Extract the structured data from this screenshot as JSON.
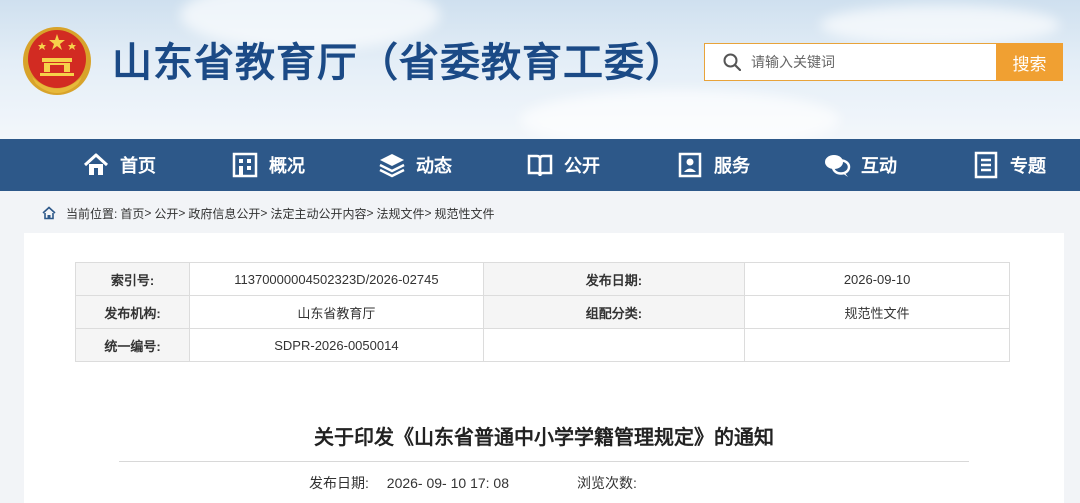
{
  "header": {
    "site_title": "山东省教育厅（省委教育工委）",
    "search_placeholder": "请输入关键词",
    "search_button": "搜索"
  },
  "nav": {
    "items": [
      {
        "label": "首页",
        "icon": "home-icon"
      },
      {
        "label": "概况",
        "icon": "building-icon"
      },
      {
        "label": "动态",
        "icon": "stack-icon"
      },
      {
        "label": "公开",
        "icon": "book-icon"
      },
      {
        "label": "服务",
        "icon": "service-icon"
      },
      {
        "label": "互动",
        "icon": "chat-icon"
      },
      {
        "label": "专题",
        "icon": "document-icon"
      }
    ]
  },
  "breadcrumb": {
    "prefix": "当前位置:",
    "items": [
      "首页",
      "公开",
      "政府信息公开",
      "法定主动公开内容",
      "法规文件",
      "规范性文件"
    ],
    "separator": ">"
  },
  "meta": {
    "index_label": "索引号:",
    "index_value": "11370000004502323D/2026-02745",
    "date_label": "发布日期:",
    "date_value": "2026-09-10",
    "org_label": "发布机构:",
    "org_value": "山东省教育厅",
    "category_label": "组配分类:",
    "category_value": "规范性文件",
    "code_label": "统一编号:",
    "code_value": "SDPR-2026-0050014"
  },
  "article": {
    "title": "关于印发《山东省普通中小学学籍管理规定》的通知",
    "publish_label": "发布日期:",
    "publish_value": "2026- 09- 10 17: 08",
    "views_label": "浏览次数:"
  },
  "colors": {
    "nav_bg": "#2d5889",
    "title": "#1b4a86",
    "search_button": "#f0a032"
  }
}
